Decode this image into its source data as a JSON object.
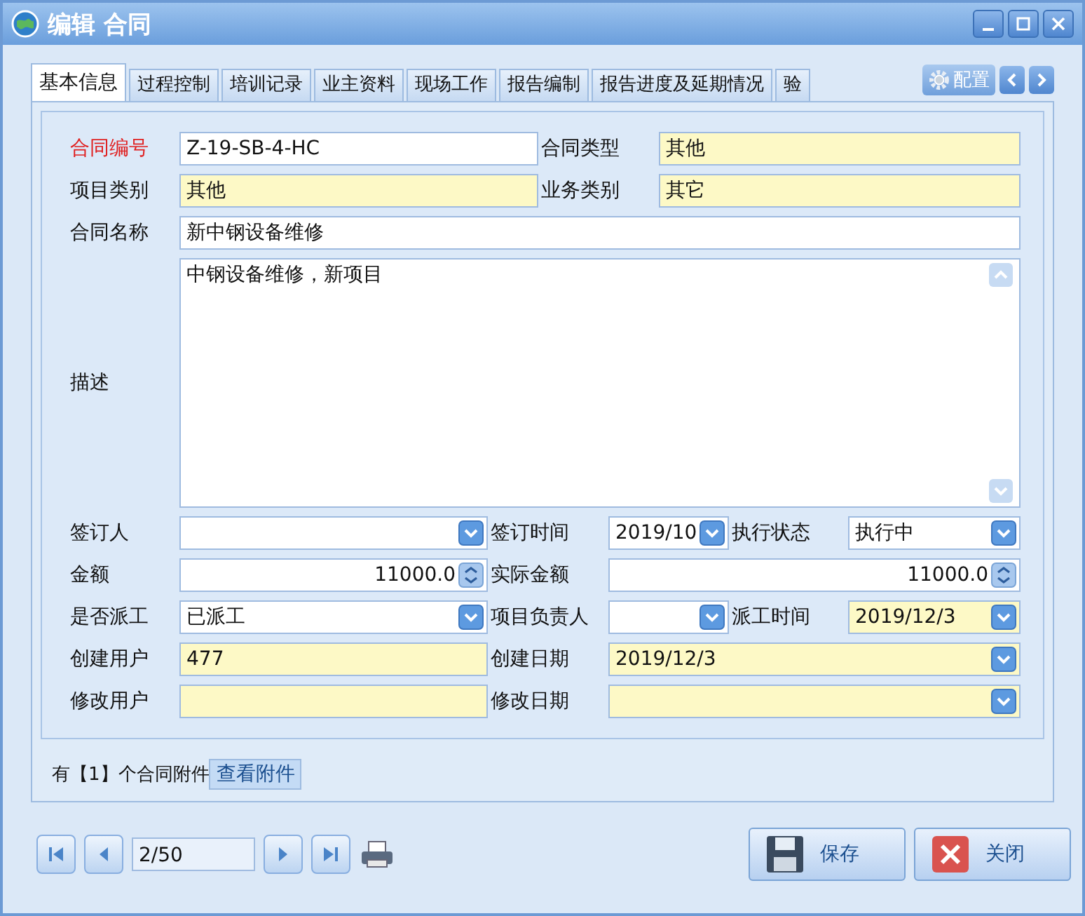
{
  "window": {
    "title": "编辑 合同"
  },
  "tabs": [
    {
      "label": "基本信息",
      "selected": true
    },
    {
      "label": "过程控制",
      "selected": false
    },
    {
      "label": "培训记录",
      "selected": false
    },
    {
      "label": "业主资料",
      "selected": false
    },
    {
      "label": "现场工作",
      "selected": false
    },
    {
      "label": "报告编制",
      "selected": false
    },
    {
      "label": "报告进度及延期情况",
      "selected": false
    },
    {
      "label": "验",
      "selected": false
    }
  ],
  "config_button": "配置",
  "rows": [
    {
      "kind": "pair",
      "cells": [
        {
          "label": "合同编号",
          "required": true,
          "kind": "text",
          "value": "Z-19-SB-4-HC",
          "readonly": false
        },
        {
          "label": "合同类型",
          "required": false,
          "kind": "text",
          "value": "其他",
          "readonly": true
        }
      ]
    },
    {
      "kind": "pair",
      "cells": [
        {
          "label": "项目类别",
          "required": false,
          "kind": "text",
          "value": "其他",
          "readonly": true
        },
        {
          "label": "业务类别",
          "required": false,
          "kind": "text",
          "value": "其它",
          "readonly": true
        }
      ]
    },
    {
      "kind": "wide",
      "cells": [
        {
          "label": "合同名称",
          "required": false,
          "kind": "text",
          "value": "新中钢设备维修",
          "readonly": false
        }
      ]
    },
    {
      "kind": "memo",
      "cells": [
        {
          "label": "描述",
          "required": false,
          "kind": "memo",
          "value": "中钢设备维修，新项目",
          "readonly": false
        }
      ]
    },
    {
      "kind": "triple",
      "cells": [
        {
          "label": "签订人",
          "required": false,
          "kind": "combo",
          "readonly": false
        },
        {
          "label": "签订时间",
          "required": false,
          "kind": "combo",
          "value": "2019/10",
          "readonly": false
        },
        {
          "label": "执行状态",
          "required": false,
          "kind": "combo",
          "value": "执行中",
          "readonly": false
        }
      ]
    },
    {
      "kind": "split",
      "cells": [
        {
          "label": "金额",
          "required": false,
          "kind": "spin",
          "value": "11000.0",
          "readonly": false
        },
        {
          "label": "实际金额",
          "required": false,
          "kind": "spin",
          "value": "11000.0",
          "readonly": false
        }
      ]
    },
    {
      "kind": "triple",
      "cells": [
        {
          "label": "是否派工",
          "required": false,
          "kind": "combo",
          "value": "已派工",
          "readonly": false
        },
        {
          "label": "项目负责人",
          "required": false,
          "kind": "combo",
          "readonly": false
        },
        {
          "label": "派工时间",
          "required": false,
          "kind": "combo",
          "value": "2019/12/3",
          "readonly": true
        }
      ]
    },
    {
      "kind": "split",
      "cells": [
        {
          "label": "创建用户",
          "required": false,
          "kind": "text",
          "value": "477",
          "readonly": true
        },
        {
          "label": "创建日期",
          "required": false,
          "kind": "combo",
          "value": "2019/12/3",
          "readonly": true
        }
      ]
    },
    {
      "kind": "split",
      "cells": [
        {
          "label": "修改用户",
          "required": false,
          "kind": "text",
          "readonly": true
        },
        {
          "label": "修改日期",
          "required": false,
          "kind": "combo",
          "readonly": true
        }
      ]
    }
  ],
  "attachments": {
    "text": "有【1】个合同附件",
    "button": "查看附件"
  },
  "navigator": {
    "position": "2/50"
  },
  "buttons": [
    "保存",
    "关闭"
  ]
}
